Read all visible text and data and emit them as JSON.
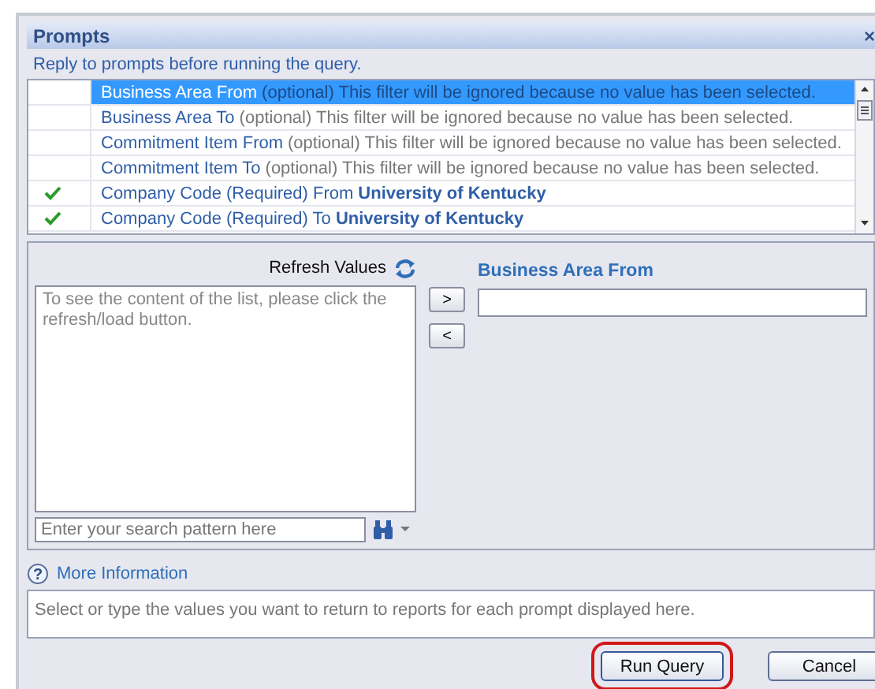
{
  "dialog": {
    "title": "Prompts",
    "close": "×",
    "instruction": "Reply to prompts before running the query."
  },
  "prompts": [
    {
      "label": "Business Area From",
      "note": "(optional) This filter will be ignored because no value has been selected.",
      "checked": false,
      "selected": true
    },
    {
      "label": "Business Area To",
      "note": "(optional) This filter will be ignored because no value has been selected.",
      "checked": false,
      "selected": false
    },
    {
      "label": "Commitment Item From",
      "note": "(optional) This filter will be ignored because no value has been selected.",
      "checked": false,
      "selected": false
    },
    {
      "label": "Commitment Item To",
      "note": "(optional) This filter will be ignored because no value has been selected.",
      "checked": false,
      "selected": false
    },
    {
      "label": "Company Code (Required) From",
      "value": "University of Kentucky",
      "checked": true,
      "selected": false
    },
    {
      "label": "Company Code (Required) To",
      "value": "University of Kentucky",
      "checked": true,
      "selected": false
    }
  ],
  "values_panel": {
    "refresh_label": "Refresh Values",
    "list_message": "To see the content of the list, please click the refresh/load button.",
    "search": {
      "placeholder": "Enter your search pattern here"
    },
    "add_button": ">",
    "remove_button": "<",
    "selected_title": "Business Area From"
  },
  "more_information": {
    "icon": "?",
    "label": "More Information",
    "text": "Select or type the values you want to return to reports for each prompt displayed here."
  },
  "buttons": [
    {
      "label": "Run Query",
      "highlighted": true
    },
    {
      "label": "Cancel",
      "highlighted": false
    }
  ]
}
